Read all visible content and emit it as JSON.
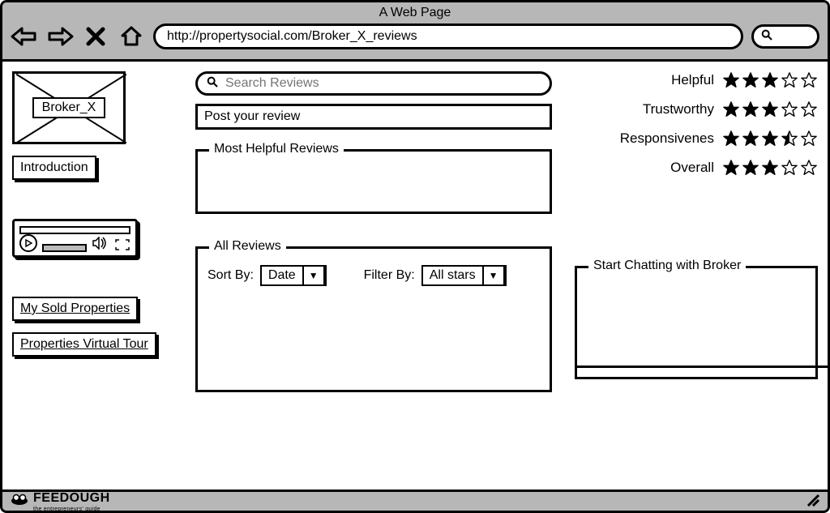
{
  "browser": {
    "title": "A Web Page",
    "url": "http://propertysocial.com/Broker_X_reviews"
  },
  "sidebar": {
    "broker_image_label": "Broker_X",
    "nav": {
      "introduction": "Introduction",
      "sold_properties": "My Sold Properties",
      "virtual_tour": "Properties Virtual Tour"
    }
  },
  "reviews": {
    "search_placeholder": "Search Reviews",
    "post_review_label": "Post your review",
    "most_helpful_legend": "Most Helpful Reviews",
    "all_reviews_legend": "All Reviews",
    "sort_by_label": "Sort By:",
    "sort_by_value": "Date",
    "filter_by_label": "Filter By:",
    "filter_by_value": "All stars"
  },
  "ratings": [
    {
      "label": "Helpful",
      "value": 3
    },
    {
      "label": "Trustworthy",
      "value": 3
    },
    {
      "label": "Responsivenes",
      "value": 3.5
    },
    {
      "label": "Overall",
      "value": 3
    }
  ],
  "chat": {
    "legend": "Start Chatting with Broker"
  },
  "footer": {
    "brand": "FEEDOUGH",
    "tagline": "the entrepreneurs' guide"
  }
}
